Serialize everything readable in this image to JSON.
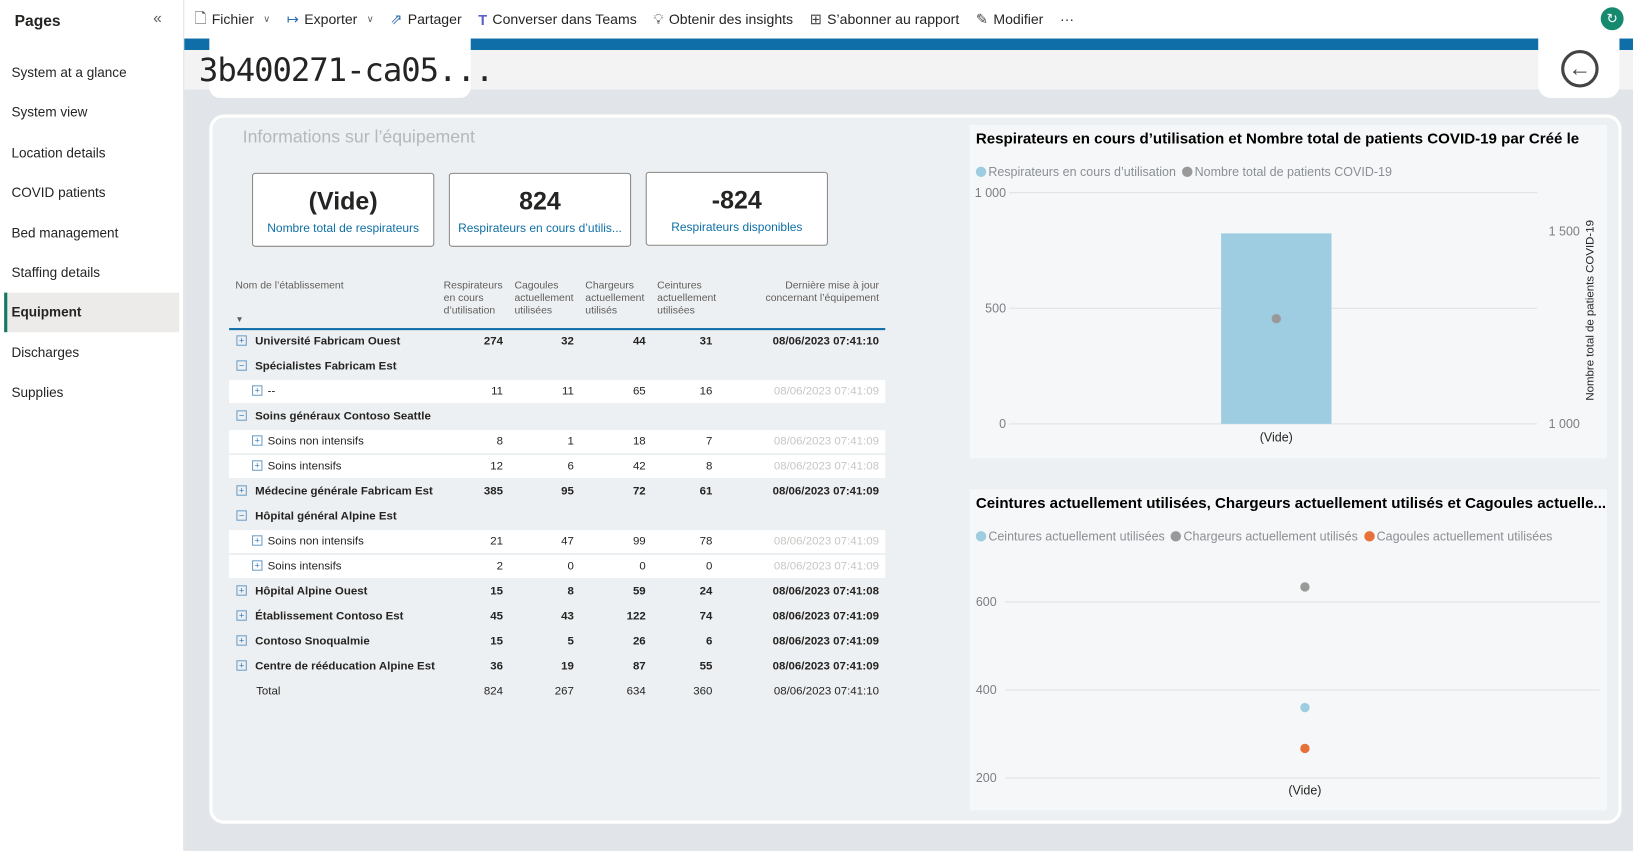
{
  "sidebar": {
    "title": "Pages",
    "items": [
      {
        "label": "System at a glance"
      },
      {
        "label": "System view"
      },
      {
        "label": "Location details"
      },
      {
        "label": "COVID patients"
      },
      {
        "label": "Bed management"
      },
      {
        "label": "Staffing details"
      },
      {
        "label": "Equipment",
        "active": true
      },
      {
        "label": "Discharges"
      },
      {
        "label": "Supplies"
      }
    ]
  },
  "toolbar": {
    "file": "Fichier",
    "export": "Exporter",
    "share": "Partager",
    "teams": "Converser dans Teams",
    "insights": "Obtenir des insights",
    "subscribe": "S’abonner au rapport",
    "edit": "Modifier",
    "more": "···"
  },
  "page_title": "3b400271-ca05...",
  "section_title": "Informations sur l’équipement",
  "kpis": [
    {
      "value": "(Vide)",
      "label": "Nombre total de respirateurs"
    },
    {
      "value": "824",
      "label": "Respirateurs en cours d’utilis..."
    },
    {
      "value": "-824",
      "label": "Respirateurs disponibles"
    }
  ],
  "table": {
    "headers": [
      "Nom de l’établissement",
      "Respirateurs en cours d’utilisation",
      "Cagoules actuellement utilisées",
      "Chargeurs actuellement utilisés",
      "Ceintures actuellement utilisées",
      "Dernière mise à jour concernant l’équipement"
    ],
    "rows": [
      {
        "name": "Université Fabricam Ouest",
        "level": 0,
        "expander": "+",
        "vals": [
          "274",
          "32",
          "44",
          "31"
        ],
        "date": "08/06/2023 07:41:10"
      },
      {
        "name": "Spécialistes Fabricam Est",
        "level": 0,
        "expander": "−",
        "vals": [
          "",
          "",
          "",
          ""
        ],
        "date": ""
      },
      {
        "name": "--",
        "level": 1,
        "expander": "+",
        "vals": [
          "11",
          "11",
          "65",
          "16"
        ],
        "date": "08/06/2023 07:41:09"
      },
      {
        "name": "Soins généraux Contoso Seattle",
        "level": 0,
        "expander": "−",
        "vals": [
          "",
          "",
          "",
          ""
        ],
        "date": ""
      },
      {
        "name": "Soins non intensifs",
        "level": 1,
        "expander": "+",
        "vals": [
          "8",
          "1",
          "18",
          "7"
        ],
        "date": "08/06/2023 07:41:09"
      },
      {
        "name": "Soins intensifs",
        "level": 1,
        "expander": "+",
        "vals": [
          "12",
          "6",
          "42",
          "8"
        ],
        "date": "08/06/2023 07:41:08"
      },
      {
        "name": "Médecine générale Fabricam Est",
        "level": 0,
        "expander": "+",
        "vals": [
          "385",
          "95",
          "72",
          "61"
        ],
        "date": "08/06/2023 07:41:09"
      },
      {
        "name": "Hôpital général Alpine Est",
        "level": 0,
        "expander": "−",
        "vals": [
          "",
          "",
          "",
          ""
        ],
        "date": ""
      },
      {
        "name": "Soins non intensifs",
        "level": 1,
        "expander": "+",
        "vals": [
          "21",
          "47",
          "99",
          "78"
        ],
        "date": "08/06/2023 07:41:09"
      },
      {
        "name": "Soins intensifs",
        "level": 1,
        "expander": "+",
        "vals": [
          "2",
          "0",
          "0",
          "0"
        ],
        "date": "08/06/2023 07:41:09"
      },
      {
        "name": "Hôpital Alpine Ouest",
        "level": 0,
        "expander": "+",
        "vals": [
          "15",
          "8",
          "59",
          "24"
        ],
        "date": "08/06/2023 07:41:08"
      },
      {
        "name": "Établissement Contoso Est",
        "level": 0,
        "expander": "+",
        "vals": [
          "45",
          "43",
          "122",
          "74"
        ],
        "date": "08/06/2023 07:41:09"
      },
      {
        "name": "Contoso Snoqualmie",
        "level": 0,
        "expander": "+",
        "vals": [
          "15",
          "5",
          "26",
          "6"
        ],
        "date": "08/06/2023 07:41:09"
      },
      {
        "name": "Centre de rééducation Alpine Est",
        "level": 0,
        "expander": "+",
        "vals": [
          "36",
          "19",
          "87",
          "55"
        ],
        "date": "08/06/2023 07:41:09"
      }
    ],
    "total": {
      "name": "Total",
      "vals": [
        "824",
        "267",
        "634",
        "360"
      ],
      "date": "08/06/2023 07:41:10"
    }
  },
  "chart_data": [
    {
      "type": "bar+line",
      "title": "Respirateurs en cours d’utilisation et Nombre total de patients COVID-19 par Créé le",
      "categories": [
        "(Vide)"
      ],
      "series": [
        {
          "name": "Respirateurs en cours d’utilisation",
          "type": "bar",
          "axis": "left",
          "values": [
            824
          ],
          "color": "#9ecde1"
        },
        {
          "name": "Nombre total de patients COVID-19",
          "type": "point",
          "axis": "right",
          "values": [
            1273
          ],
          "color": "#999999"
        }
      ],
      "ylim": [
        0,
        1000
      ],
      "yticks": [
        "0",
        "500",
        "1 000"
      ],
      "yticks_values": [
        0,
        500,
        1000
      ],
      "y2lim": [
        1000,
        1500
      ],
      "y2ticks": [
        "1 000",
        "1 500"
      ],
      "y2ticks_values": [
        1000,
        1500
      ],
      "y2label": "Nombre total de patients COVID-19",
      "legend": "top-left",
      "grid": true
    },
    {
      "type": "scatter",
      "title": "Ceintures actuellement utilisées, Chargeurs actuellement utilisés et Cagoules actuelle...",
      "categories": [
        "(Vide)"
      ],
      "series": [
        {
          "name": "Ceintures actuellement utilisées",
          "values": [
            360
          ],
          "color": "#9ecde1"
        },
        {
          "name": "Chargeurs actuellement utilisés",
          "values": [
            634
          ],
          "color": "#999999"
        },
        {
          "name": "Cagoules actuellement utilisées",
          "values": [
            267
          ],
          "color": "#e8703a"
        }
      ],
      "ylim": [
        200,
        600
      ],
      "yticks": [
        "200",
        "400",
        "600"
      ],
      "yticks_values": [
        200,
        400,
        600
      ],
      "legend": "top-left",
      "grid": true
    }
  ]
}
